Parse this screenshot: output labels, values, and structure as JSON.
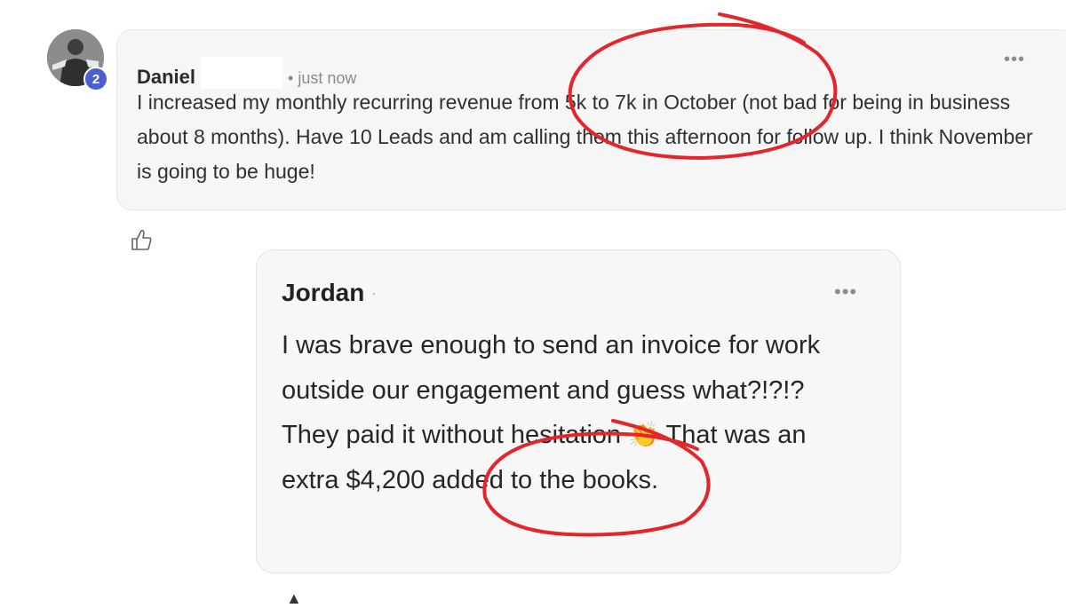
{
  "post": {
    "author": "Daniel",
    "badge_level": "2",
    "time": "• just now",
    "more_label": "•••",
    "body": "I increased my monthly recurring revenue from 5k to 7k in October (not bad for being in business about 8 months). Have 10 Leads and am calling them this afternoon for follow up. I think November is going to be huge!"
  },
  "comment": {
    "author": "Jordan",
    "author_mark": "·",
    "more_label": "•••",
    "body": "I was brave enough to send an invoice for work outside our engagement and guess what?!?!? They paid it without hesitation",
    "emoji": "👏",
    "body_2": "That was an extra $4,200 added to the books."
  },
  "icons": {
    "like": "thumbs-up-icon",
    "more": "more-dots-icon"
  },
  "colors": {
    "annotation_red": "#e3262b",
    "badge_blue": "#4a5fd1",
    "card_bg": "#f6f6f6"
  }
}
